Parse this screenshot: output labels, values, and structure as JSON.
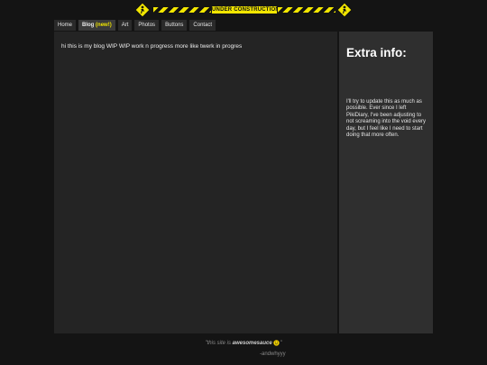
{
  "banner": {
    "label": "UNDER CONSTRUCTION"
  },
  "nav": {
    "items": [
      {
        "label": "Home"
      },
      {
        "label": "Blog",
        "badge": "(new!)"
      },
      {
        "label": "Art"
      },
      {
        "label": "Photos"
      },
      {
        "label": "Buttons"
      },
      {
        "label": "Contact"
      }
    ]
  },
  "main": {
    "text": "hi this is my blog WIP WIP work n progress more like twerk in progres"
  },
  "sidebar": {
    "title": "Extra info:",
    "body": "I'll try to update this as much as possible. Ever since I left PikiDiary, I've been adjusting to not screaming into the void every day, but I feel like I need to start doing that more often."
  },
  "footer": {
    "quote_prefix": "\"this site is ",
    "quote_bold": "awesomesauce",
    "quote_suffix": "\"",
    "author": "-andwhyyy"
  },
  "colors": {
    "accent": "#f2e600",
    "background": "#141414"
  },
  "icons": {
    "banner_sign": "construction-worker-sign-icon",
    "footer": "smiley-icon"
  }
}
